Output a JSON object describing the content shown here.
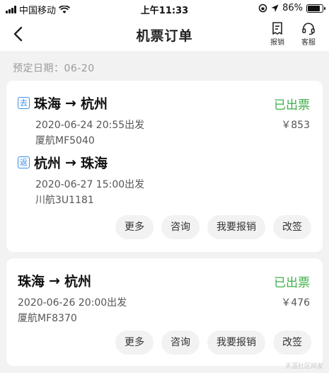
{
  "status_bar": {
    "carrier": "中国移动",
    "time": "上午11:33",
    "battery": "86%",
    "battery_level": 0.86
  },
  "nav": {
    "title": "机票订单",
    "report_label": "报销",
    "service_label": "客服"
  },
  "booking_date": "预定日期：06-20",
  "orders": [
    {
      "status": "已出票",
      "price": "￥853",
      "segments": [
        {
          "tag": "去",
          "from": "珠海",
          "to": "杭州",
          "time": "2020-06-24 20:55出发",
          "flight": "厦航MF5040"
        },
        {
          "tag": "返",
          "from": "杭州",
          "to": "珠海",
          "time": "2020-06-27 15:00出发",
          "flight": "川航3U1181"
        }
      ],
      "buttons": [
        "更多",
        "咨询",
        "我要报销",
        "改签"
      ]
    },
    {
      "status": "已出票",
      "price": "￥476",
      "segments": [
        {
          "from": "珠海",
          "to": "杭州",
          "time": "2020-06-26 20:00出发",
          "flight": "厦航MF8370"
        }
      ],
      "buttons": [
        "更多",
        "咨询",
        "我要报销",
        "改签"
      ]
    }
  ],
  "watermark": "天涯社区网友"
}
